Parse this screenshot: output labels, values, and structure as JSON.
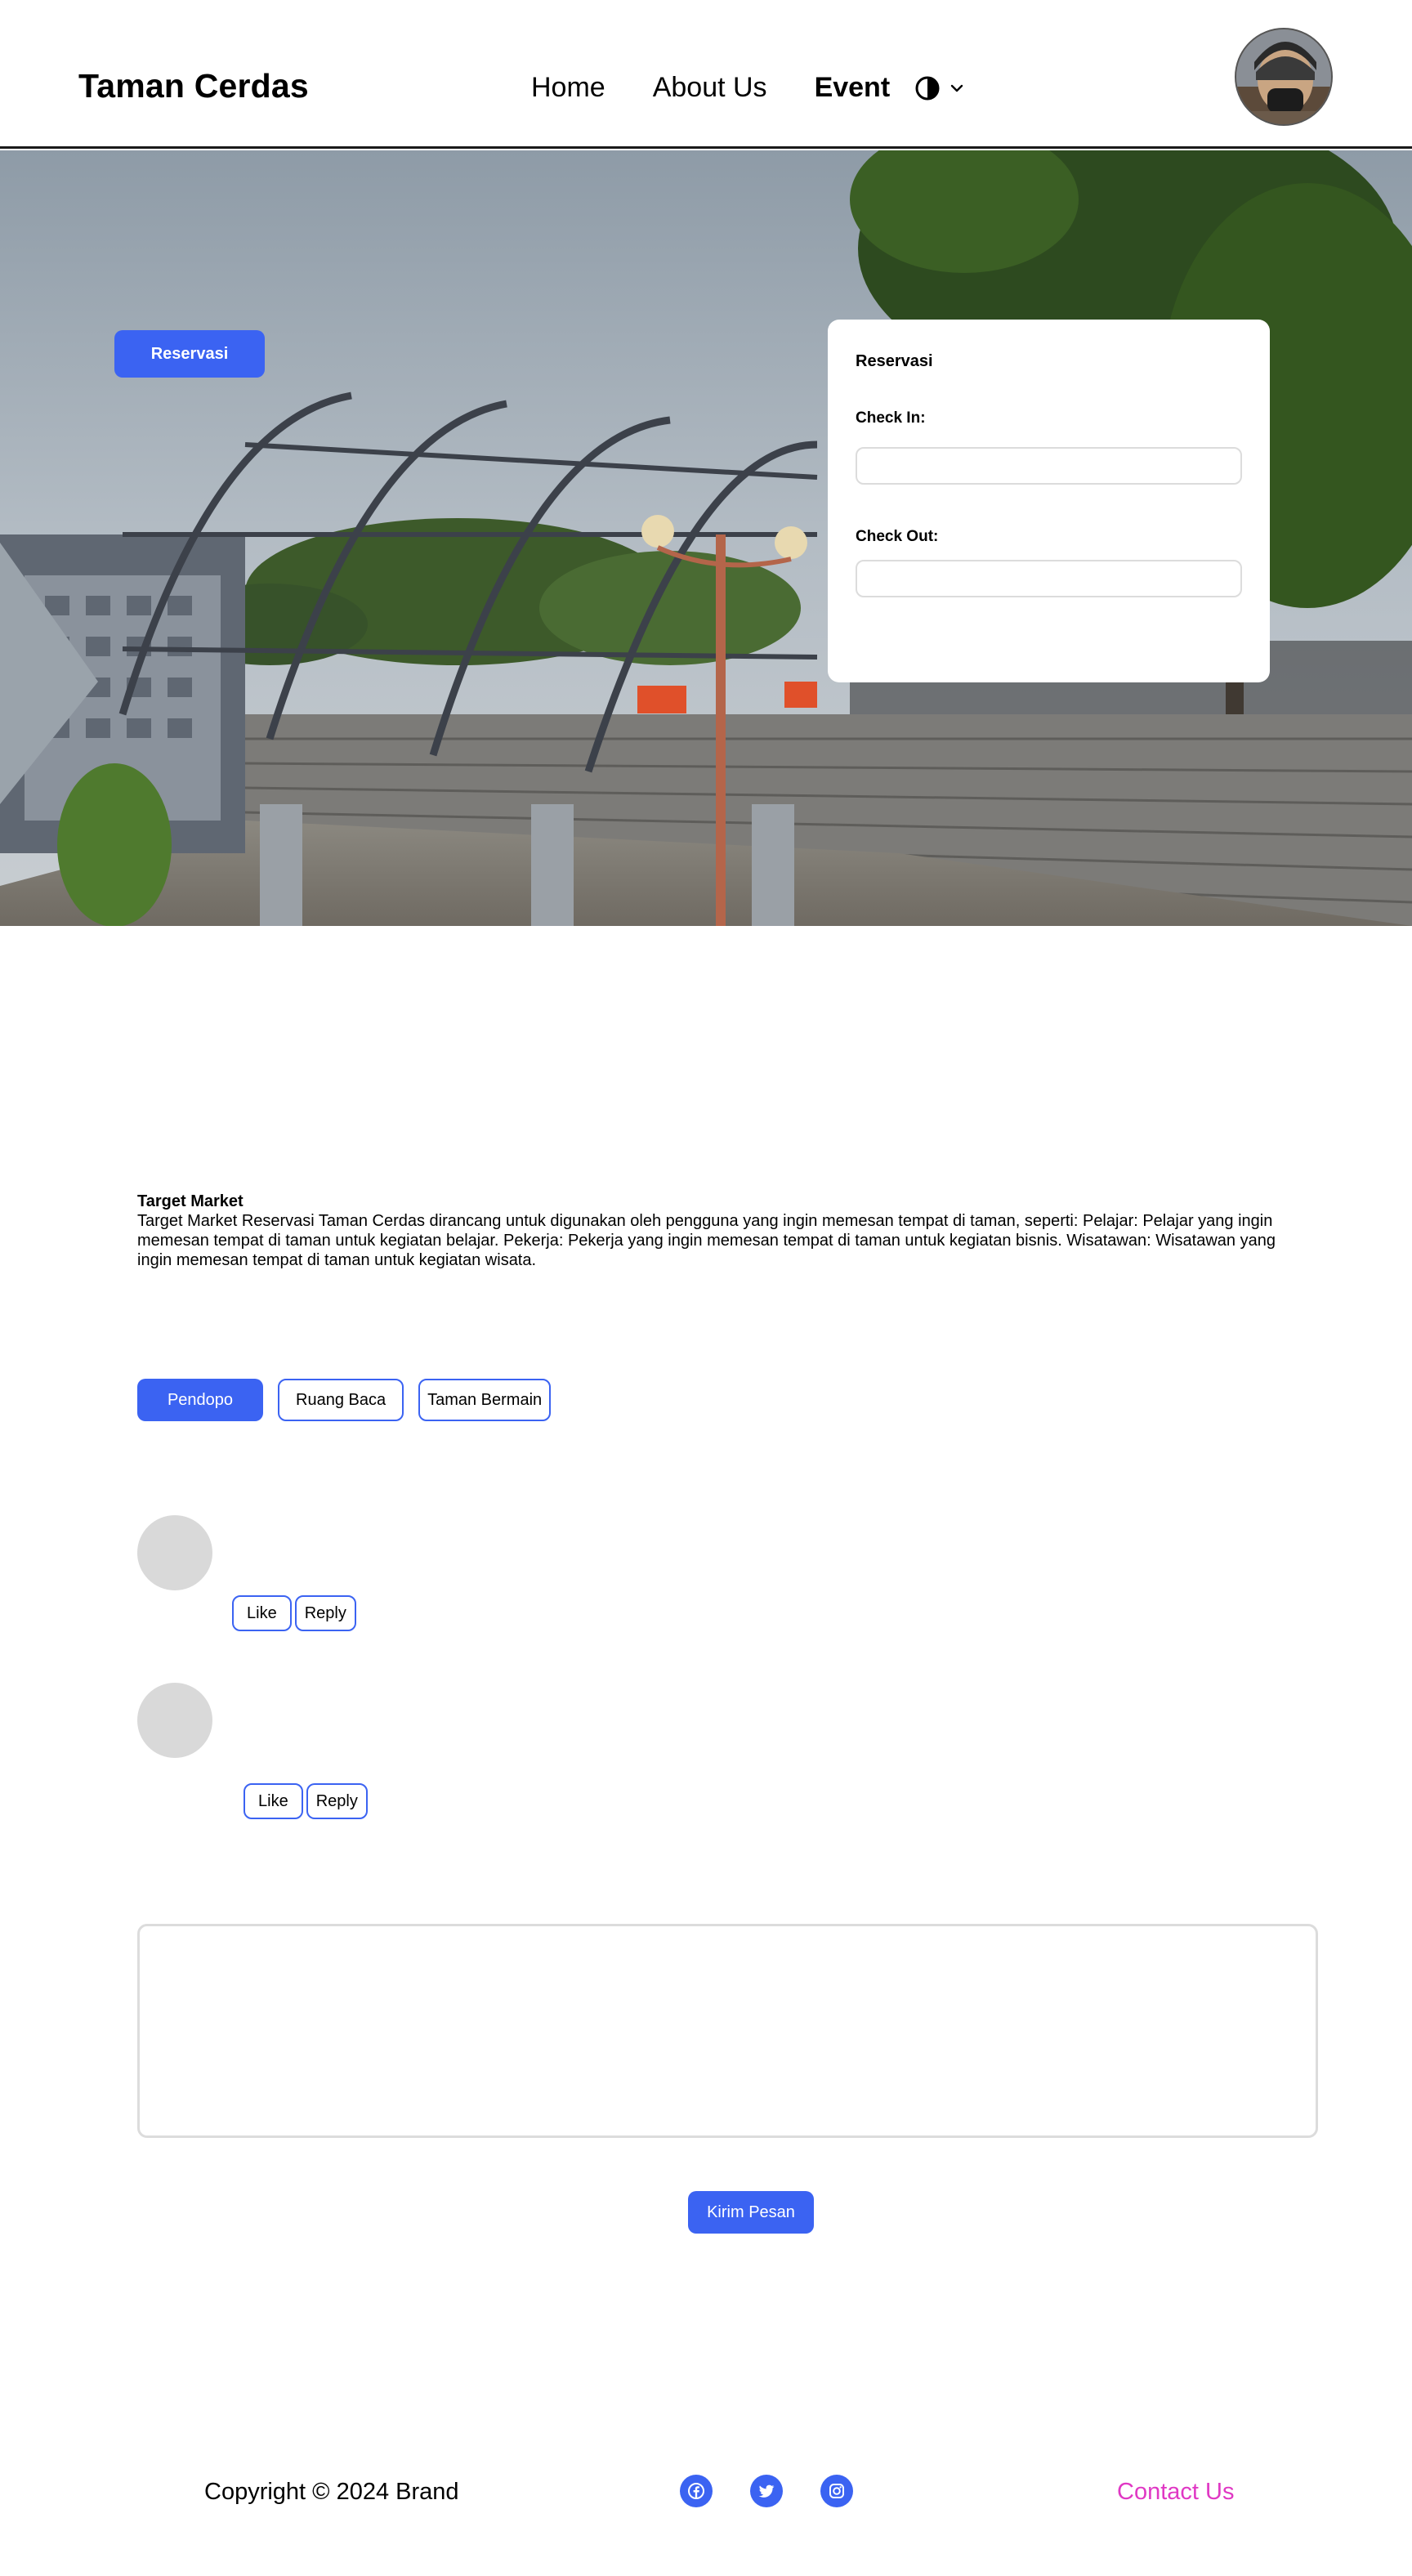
{
  "header": {
    "brand": "Taman Cerdas",
    "nav": [
      {
        "label": "Home"
      },
      {
        "label": "About Us"
      },
      {
        "label": "Event"
      }
    ],
    "theme_icon": "contrast-icon",
    "theme_caret_icon": "chevron-down-icon",
    "avatar_icon": "user-avatar"
  },
  "hero": {
    "button_label": "Reservasi",
    "card": {
      "title": "Reservasi",
      "check_in_label": "Check In:",
      "check_in_value": "",
      "check_out_label": "Check Out:",
      "check_out_value": ""
    }
  },
  "info": {
    "title": "Target Market",
    "body": "Target Market Reservasi Taman Cerdas dirancang untuk digunakan oleh pengguna yang ingin memesan tempat di taman, seperti: Pelajar: Pelajar yang ingin memesan tempat di taman untuk kegiatan belajar. Pekerja: Pekerja yang ingin memesan tempat di taman untuk kegiatan bisnis. Wisatawan: Wisatawan yang ingin memesan tempat di taman untuk kegiatan wisata."
  },
  "tabs": [
    {
      "label": "Pendopo"
    },
    {
      "label": "Ruang Baca"
    },
    {
      "label": "Taman Bermain"
    }
  ],
  "comments": [
    {
      "like_label": "Like",
      "reply_label": "Reply"
    },
    {
      "like_label": "Like",
      "reply_label": "Reply"
    }
  ],
  "message": {
    "value": "",
    "send_label": "Kirim Pesan"
  },
  "footer": {
    "copyright": "Copyright © 2024 Brand",
    "social_icons": [
      "facebook-icon",
      "twitter-icon",
      "instagram-icon"
    ],
    "contact_label": "Contact Us"
  },
  "colors": {
    "primary": "#3b63f2",
    "contact_link": "#e038c4",
    "avatar_placeholder": "#d9d9d9"
  }
}
